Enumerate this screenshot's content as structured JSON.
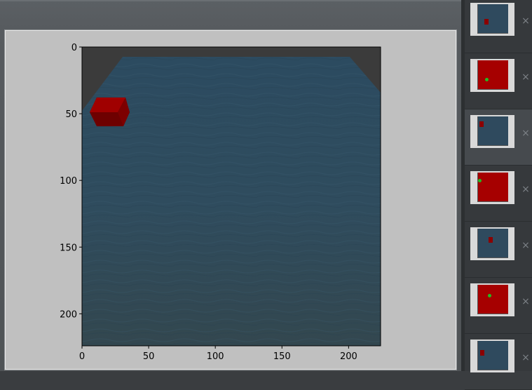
{
  "colors": {
    "figure_background": "#c0c0c0",
    "table_surface": "#2f4a5e",
    "cube": "#8b0000",
    "red_thumb": "#a60000",
    "green_marker": "#22bb22"
  },
  "plot": {
    "image_width": 224,
    "image_height": 224,
    "x_ticks": [
      "0",
      "50",
      "100",
      "150",
      "200"
    ],
    "y_ticks": [
      "0",
      "50",
      "100",
      "150",
      "200"
    ],
    "x_tick_values": [
      0,
      50,
      100,
      150,
      200
    ],
    "y_tick_values": [
      0,
      50,
      100,
      150,
      200
    ]
  },
  "thumbnails": [
    {
      "kind": "scene",
      "marker": "red-cube",
      "mx": 0.28,
      "my": 0.58,
      "close_label": "×"
    },
    {
      "kind": "red",
      "marker": "green-dot",
      "mx": 0.3,
      "my": 0.68,
      "close_label": "×"
    },
    {
      "kind": "scene",
      "marker": "red-cube",
      "mx": 0.12,
      "my": 0.25,
      "close_label": "×",
      "selected": true
    },
    {
      "kind": "red",
      "marker": "green-dot",
      "mx": 0.08,
      "my": 0.3,
      "close_label": "×"
    },
    {
      "kind": "scene",
      "marker": "red-cube",
      "mx": 0.43,
      "my": 0.36,
      "close_label": "×"
    },
    {
      "kind": "red",
      "marker": "green-dot",
      "mx": 0.4,
      "my": 0.4,
      "close_label": "×"
    },
    {
      "kind": "scene",
      "marker": "red-cube",
      "mx": 0.15,
      "my": 0.4,
      "close_label": "×"
    }
  ]
}
